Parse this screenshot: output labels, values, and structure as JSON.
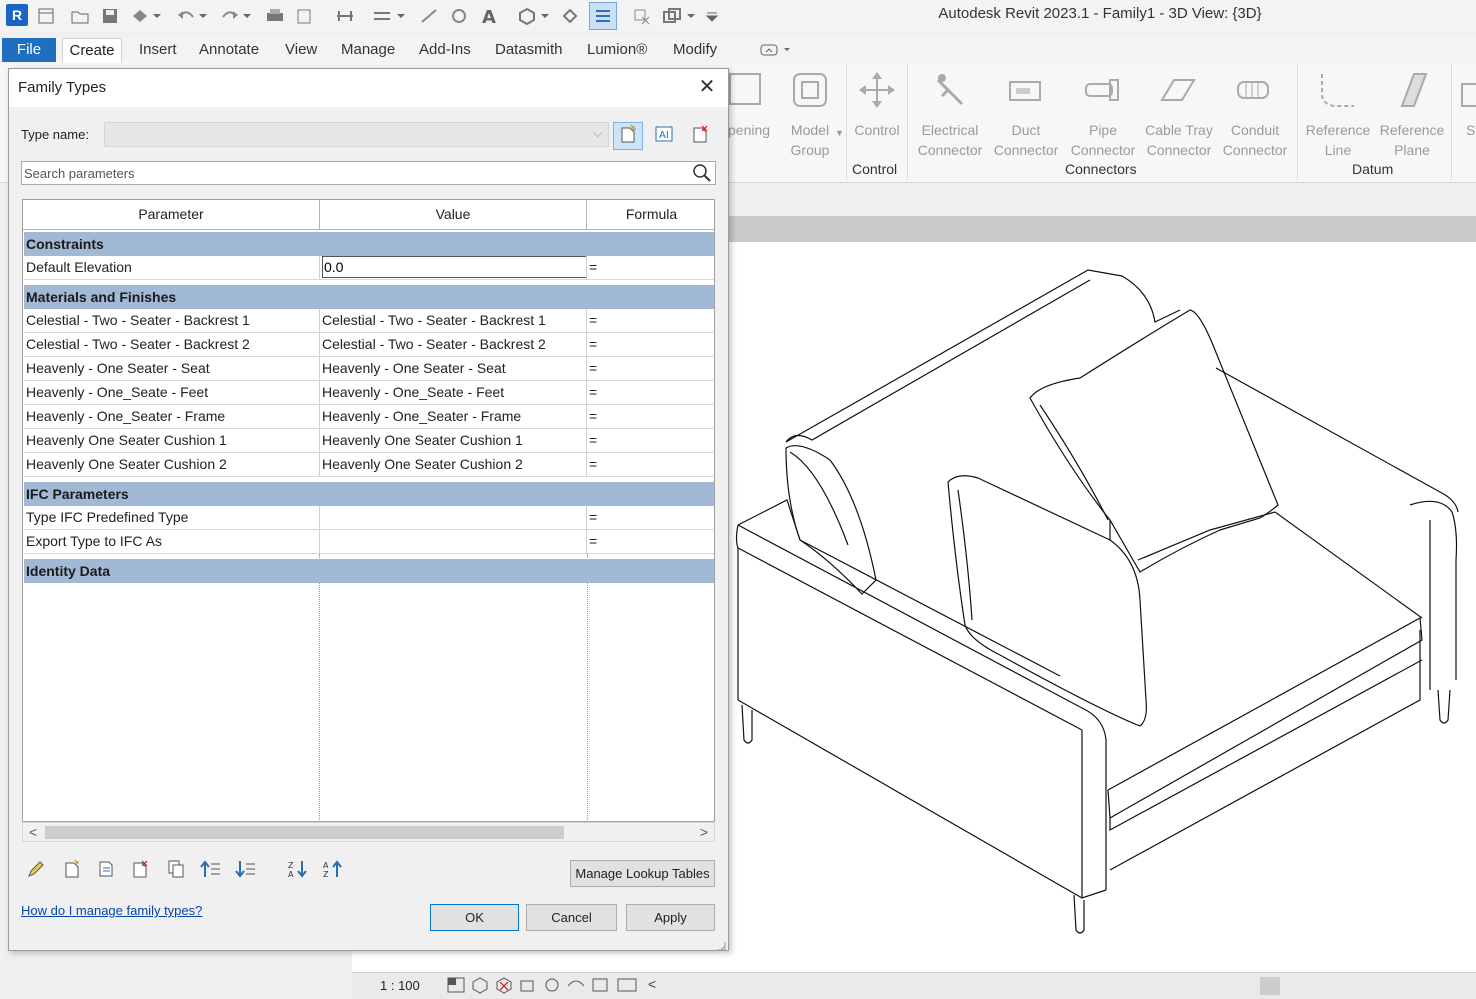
{
  "window": {
    "title": "Autodesk Revit 2023.1 - Family1 - 3D View: {3D}"
  },
  "menu": {
    "file": "File",
    "create": "Create",
    "insert": "Insert",
    "annotate": "Annotate",
    "view": "View",
    "manage": "Manage",
    "addins": "Add-Ins",
    "datasmith": "Datasmith",
    "lumion": "Lumion®",
    "modify": "Modify"
  },
  "ribbon": {
    "opening": "pening",
    "model_group": [
      "Model",
      "Group"
    ],
    "control": "Control",
    "electrical": [
      "Electrical",
      "Connector"
    ],
    "duct": [
      "Duct",
      "Connector"
    ],
    "pipe": [
      "Pipe",
      "Connector"
    ],
    "cabletray": [
      "Cable Tray",
      "Connector"
    ],
    "conduit": [
      "Conduit",
      "Connector"
    ],
    "refline": [
      "Reference",
      "Line"
    ],
    "refplane": [
      "Reference",
      "Plane"
    ],
    "trunc": "S",
    "groups": {
      "control": "Control",
      "connectors": "Connectors",
      "datum": "Datum"
    }
  },
  "dialog": {
    "title": "Family Types",
    "type_name_label": "Type name:",
    "search_placeholder": "Search parameters",
    "columns": {
      "parameter": "Parameter",
      "value": "Value",
      "formula": "Formula"
    },
    "groups": {
      "constraints": "Constraints",
      "materials": "Materials and Finishes",
      "ifc": "IFC Parameters",
      "identity": "Identity Data"
    },
    "default_elevation": {
      "name": "Default Elevation",
      "value": "0.0",
      "formula": "="
    },
    "materials_rows": [
      {
        "name": "Celestial - Two - Seater - Backrest 1",
        "value": "Celestial - Two - Seater - Backrest 1",
        "formula": "="
      },
      {
        "name": "Celestial - Two - Seater - Backrest 2",
        "value": "Celestial - Two - Seater - Backrest 2",
        "formula": "="
      },
      {
        "name": "Heavenly - One Seater - Seat",
        "value": "Heavenly - One Seater - Seat",
        "formula": "="
      },
      {
        "name": "Heavenly - One_Seate - Feet",
        "value": "Heavenly - One_Seate - Feet",
        "formula": "="
      },
      {
        "name": "Heavenly - One_Seater - Frame",
        "value": "Heavenly - One_Seater - Frame",
        "formula": "="
      },
      {
        "name": "Heavenly One Seater Cushion 1",
        "value": "Heavenly One Seater Cushion 1",
        "formula": "="
      },
      {
        "name": "Heavenly One Seater Cushion 2",
        "value": "Heavenly One Seater Cushion 2",
        "formula": "="
      }
    ],
    "ifc_rows": [
      {
        "name": "Type IFC Predefined Type",
        "value": "",
        "formula": "="
      },
      {
        "name": "Export Type to IFC As",
        "value": "",
        "formula": "="
      }
    ],
    "manage_lookup": "Manage Lookup Tables",
    "help_link": "How do I manage family types?",
    "ok": "OK",
    "cancel": "Cancel",
    "apply": "Apply"
  },
  "status": {
    "scale": "1 : 100"
  },
  "colors": {
    "accent": "#1e6fc0",
    "group_header": "#a2b9d6"
  }
}
